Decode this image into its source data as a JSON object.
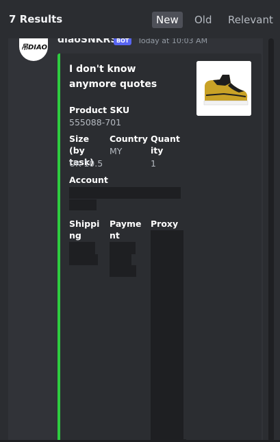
{
  "header": {
    "results_label": "7 Results",
    "sort_tabs": [
      {
        "label": "New",
        "active": true
      },
      {
        "label": "Old",
        "active": false
      },
      {
        "label": "Relevant",
        "active": false
      }
    ]
  },
  "message": {
    "username": "diaoSNKRS",
    "bot_tag": "BOT",
    "timestamp": "Today at 10:03 AM",
    "avatar_text": "吊DIAO"
  },
  "embed": {
    "accent_color": "#2ecc40",
    "title": "I don't know anymore quotes",
    "product_sku_name": "Product SKU",
    "product_sku_value": "555088-701",
    "size_name": "Size (by task)",
    "size_value": "UK 10.5",
    "country_name": "Country",
    "country_value": "MY",
    "quantity_name": "Quantity",
    "quantity_value": "1",
    "account_name": "Account",
    "shipping_name": "Shipping",
    "payment_name": "Payment",
    "proxy_name": "Proxy"
  }
}
